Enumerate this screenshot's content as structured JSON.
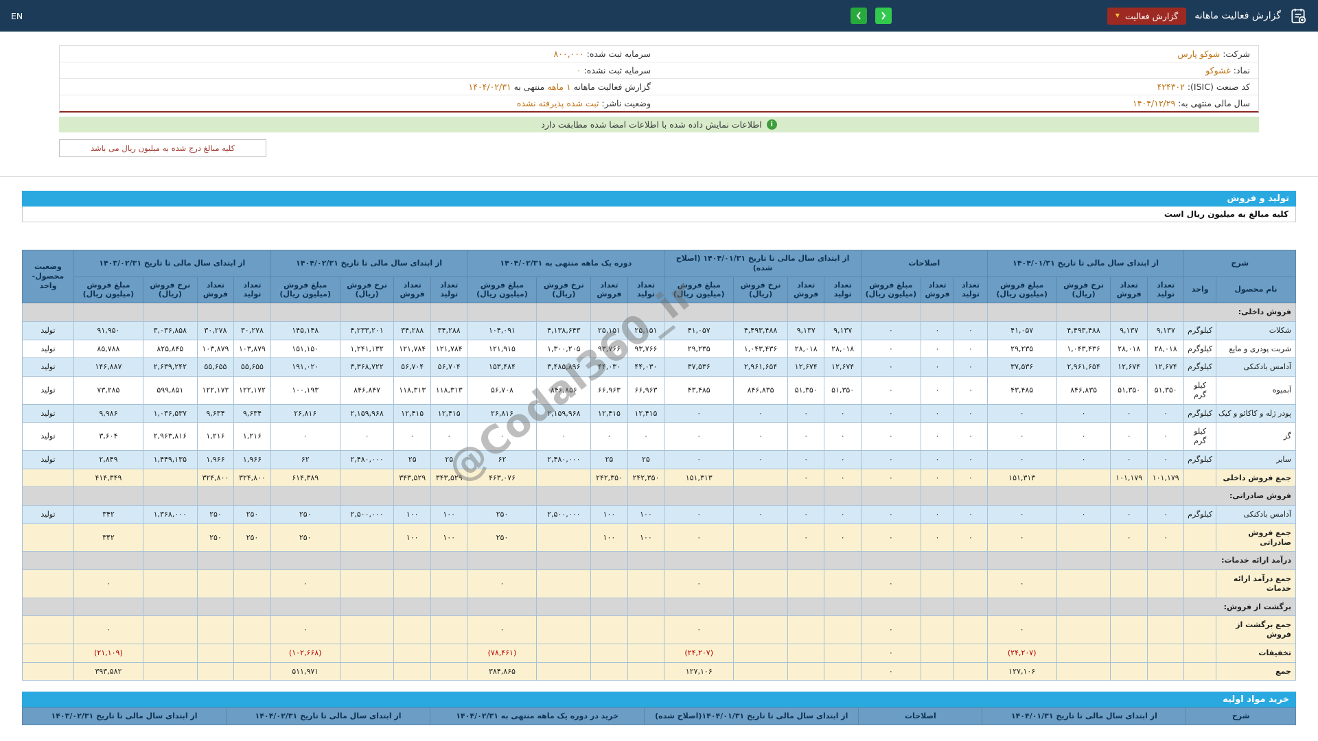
{
  "navbar": {
    "title": "گزارش فعالیت ماهانه",
    "dropdown_label": "گزارش فعالیت",
    "lang": "EN"
  },
  "company_info": {
    "rows": [
      {
        "right": [
          {
            "t": "شرکت: ",
            "c": "lbl"
          },
          {
            "t": "شوکو پارس",
            "c": "val"
          }
        ],
        "left": [
          {
            "t": "سرمایه ثبت شده: ",
            "c": "lbl"
          },
          {
            "t": "۸۰۰,۰۰۰",
            "c": "val"
          }
        ]
      },
      {
        "right": [
          {
            "t": "نماد: ",
            "c": "lbl"
          },
          {
            "t": "غشوکو",
            "c": "val"
          }
        ],
        "left": [
          {
            "t": "سرمایه ثبت نشده: ",
            "c": "lbl"
          },
          {
            "t": "۰",
            "c": "val"
          }
        ]
      },
      {
        "right": [
          {
            "t": "کد صنعت (ISIC): ",
            "c": "lbl"
          },
          {
            "t": "۴۲۴۳۰۲",
            "c": "val"
          }
        ],
        "left": [
          {
            "t": "گزارش فعالیت ماهانه ",
            "c": "lbl"
          },
          {
            "t": "۱ ماهه",
            "c": "val"
          },
          {
            "t": " منتهی به ",
            "c": "lbl"
          },
          {
            "t": "۱۴۰۴/۰۲/۳۱",
            "c": "val"
          }
        ]
      },
      {
        "right": [
          {
            "t": "سال مالی منتهی به: ",
            "c": "lbl"
          },
          {
            "t": "۱۴۰۴/۱۲/۲۹",
            "c": "val"
          }
        ],
        "left": [
          {
            "t": "وضعیت ناشر: ",
            "c": "lbl"
          },
          {
            "t": "ثبت شده پذیرفته نشده",
            "c": "val"
          }
        ]
      }
    ]
  },
  "banner": {
    "text": "اطلاعات نمایش داده شده با اطلاعات امضا شده مطابقت دارد"
  },
  "amounts_note": "کلیه مبالغ درج شده به میلیون ریال می باشد",
  "production": {
    "title": "تولید و فروش",
    "note": "کلیه مبالغ به میلیون ریال است"
  },
  "materials": {
    "title": "خرید مواد اولیه"
  },
  "watermark": "@Codal360_ir",
  "production_table": {
    "header_groups": [
      {
        "title": "شرح",
        "subs": [
          "نام محصول",
          "واحد"
        ]
      },
      {
        "title": "از ابتدای سال مالی تا تاریخ ۱۴۰۴/۰۱/۳۱",
        "subs": [
          "تعداد تولید",
          "تعداد فروش",
          "نرخ فروش (ریال)",
          "مبلغ فروش (میلیون ریال)"
        ]
      },
      {
        "title": "اصلاحات",
        "subs": [
          "تعداد تولید",
          "تعداد فروش",
          "مبلغ فروش (میلیون ریال)"
        ]
      },
      {
        "title": "از ابتدای سال مالی تا تاریخ ۱۴۰۴/۰۱/۳۱ (اصلاح شده)",
        "subs": [
          "تعداد تولید",
          "تعداد فروش",
          "نرخ فروش (ریال)",
          "مبلغ فروش (میلیون ریال)"
        ]
      },
      {
        "title": "دوره یک ماهه منتهی به ۱۴۰۴/۰۲/۳۱",
        "subs": [
          "تعداد تولید",
          "تعداد فروش",
          "نرخ فروش (ریال)",
          "مبلغ فروش (میلیون ریال)"
        ]
      },
      {
        "title": "از ابتدای سال مالی تا تاریخ ۱۴۰۴/۰۲/۳۱",
        "subs": [
          "تعداد تولید",
          "تعداد فروش",
          "نرخ فروش (ریال)",
          "مبلغ فروش (میلیون ریال)"
        ]
      },
      {
        "title": "از ابتدای سال مالی تا تاریخ ۱۴۰۳/۰۲/۳۱",
        "subs": [
          "تعداد تولید",
          "تعداد فروش",
          "نرخ فروش (ریال)",
          "مبلغ فروش (میلیون ریال)"
        ]
      },
      {
        "title": "وضعیت محصول-واحد",
        "subs": []
      }
    ],
    "rows": [
      {
        "type": "section",
        "label": "فروش داخلی:"
      },
      {
        "type": "data",
        "shade": "blue",
        "cells": [
          "شکلات",
          "کیلوگرم",
          "۹,۱۳۷",
          "۹,۱۳۷",
          "۴,۴۹۳,۴۸۸",
          "۴۱,۰۵۷",
          "۰",
          "۰",
          "۰",
          "۹,۱۳۷",
          "۹,۱۳۷",
          "۴,۴۹۳,۴۸۸",
          "۴۱,۰۵۷",
          "۲۵,۱۵۱",
          "۲۵,۱۵۱",
          "۴,۱۳۸,۶۴۳",
          "۱۰۴,۰۹۱",
          "۳۴,۲۸۸",
          "۳۴,۲۸۸",
          "۴,۲۳۳,۲۰۱",
          "۱۴۵,۱۴۸",
          "۳۰,۲۷۸",
          "۳۰,۲۷۸",
          "۳,۰۳۶,۸۵۸",
          "۹۱,۹۵۰",
          "تولید"
        ]
      },
      {
        "type": "data",
        "shade": "white",
        "cells": [
          "شربت پودری و مایع",
          "کیلوگرم",
          "۲۸,۰۱۸",
          "۲۸,۰۱۸",
          "۱,۰۴۳,۴۳۶",
          "۲۹,۲۳۵",
          "۰",
          "۰",
          "۰",
          "۲۸,۰۱۸",
          "۲۸,۰۱۸",
          "۱,۰۴۳,۴۳۶",
          "۲۹,۲۳۵",
          "۹۳,۷۶۶",
          "۹۳,۷۶۶",
          "۱,۳۰۰,۲۰۵",
          "۱۲۱,۹۱۵",
          "۱۲۱,۷۸۴",
          "۱۲۱,۷۸۴",
          "۱,۲۴۱,۱۳۲",
          "۱۵۱,۱۵۰",
          "۱۰۳,۸۷۹",
          "۱۰۳,۸۷۹",
          "۸۲۵,۸۴۵",
          "۸۵,۷۸۸",
          "تولید"
        ]
      },
      {
        "type": "data",
        "shade": "blue",
        "cells": [
          "آدامس بادکنکی",
          "کیلوگرم",
          "۱۲,۶۷۴",
          "۱۲,۶۷۴",
          "۲,۹۶۱,۶۵۴",
          "۳۷,۵۳۶",
          "۰",
          "۰",
          "۰",
          "۱۲,۶۷۴",
          "۱۲,۶۷۴",
          "۲,۹۶۱,۶۵۴",
          "۳۷,۵۳۶",
          "۴۴,۰۳۰",
          "۴۴,۰۳۰",
          "۳,۴۸۵,۸۹۶",
          "۱۵۳,۴۸۴",
          "۵۶,۷۰۴",
          "۵۶,۷۰۴",
          "۳,۳۶۸,۷۲۲",
          "۱۹۱,۰۲۰",
          "۵۵,۶۵۵",
          "۵۵,۶۵۵",
          "۲,۶۳۹,۲۴۲",
          "۱۴۶,۸۸۷",
          "تولید"
        ]
      },
      {
        "type": "data",
        "shade": "white",
        "cells": [
          "آبمیوه",
          "کیلو گرم",
          "۵۱,۳۵۰",
          "۵۱,۳۵۰",
          "۸۴۶,۸۳۵",
          "۴۳,۴۸۵",
          "۰",
          "۰",
          "۰",
          "۵۱,۳۵۰",
          "۵۱,۳۵۰",
          "۸۴۶,۸۳۵",
          "۴۳,۴۸۵",
          "۶۶,۹۶۳",
          "۶۶,۹۶۳",
          "۸۴۶,۸۵۶",
          "۵۶,۷۰۸",
          "۱۱۸,۳۱۳",
          "۱۱۸,۳۱۳",
          "۸۴۶,۸۴۷",
          "۱۰۰,۱۹۳",
          "۱۲۲,۱۷۲",
          "۱۲۲,۱۷۲",
          "۵۹۹,۸۵۱",
          "۷۳,۲۸۵",
          "تولید"
        ]
      },
      {
        "type": "data",
        "shade": "blue",
        "cells": [
          "پودر ژله و کاکائو و کیک",
          "کیلوگرم",
          "۰",
          "۰",
          "۰",
          "۰",
          "۰",
          "۰",
          "۰",
          "۰",
          "۰",
          "۰",
          "۰",
          "۱۲,۴۱۵",
          "۱۲,۴۱۵",
          "۲,۱۵۹,۹۶۸",
          "۲۶,۸۱۶",
          "۱۲,۴۱۵",
          "۱۲,۴۱۵",
          "۲,۱۵۹,۹۶۸",
          "۲۶,۸۱۶",
          "۹,۶۳۴",
          "۹,۶۳۴",
          "۱,۰۳۶,۵۳۷",
          "۹,۹۸۶",
          "تولید"
        ]
      },
      {
        "type": "data",
        "shade": "white",
        "cells": [
          "گز",
          "کیلو گرم",
          "۰",
          "۰",
          "۰",
          "۰",
          "۰",
          "۰",
          "۰",
          "۰",
          "۰",
          "۰",
          "۰",
          "۰",
          "۰",
          "۰",
          "۰",
          "۰",
          "۰",
          "۰",
          "۰",
          "۱,۲۱۶",
          "۱,۲۱۶",
          "۲,۹۶۳,۸۱۶",
          "۳,۶۰۴",
          "تولید"
        ]
      },
      {
        "type": "data",
        "shade": "blue",
        "cells": [
          "سایر",
          "کیلوگرم",
          "۰",
          "۰",
          "۰",
          "۰",
          "۰",
          "۰",
          "۰",
          "۰",
          "۰",
          "۰",
          "۰",
          "۲۵",
          "۲۵",
          "۲,۴۸۰,۰۰۰",
          "۶۲",
          "۲۵",
          "۲۵",
          "۲,۴۸۰,۰۰۰",
          "۶۲",
          "۱,۹۶۶",
          "۱,۹۶۶",
          "۱,۴۴۹,۱۳۵",
          "۲,۸۴۹",
          "تولید"
        ]
      },
      {
        "type": "total",
        "cells": [
          "جمع فروش داخلی",
          "",
          "۱۰۱,۱۷۹",
          "۱۰۱,۱۷۹",
          "",
          "۱۵۱,۳۱۳",
          "۰",
          "۰",
          "۰",
          "۰",
          "۰",
          "",
          "۱۵۱,۳۱۳",
          "۲۴۲,۳۵۰",
          "۲۴۲,۳۵۰",
          "",
          "۴۶۳,۰۷۶",
          "۳۴۳,۵۲۹",
          "۳۴۳,۵۲۹",
          "",
          "۶۱۴,۳۸۹",
          "۳۲۴,۸۰۰",
          "۳۲۴,۸۰۰",
          "",
          "۴۱۴,۳۴۹",
          ""
        ]
      },
      {
        "type": "section",
        "label": "فروش صادراتی:"
      },
      {
        "type": "data",
        "shade": "blue",
        "cells": [
          "آدامس بادکنکی",
          "کیلوگرم",
          "۰",
          "۰",
          "۰",
          "۰",
          "۰",
          "۰",
          "۰",
          "۰",
          "۰",
          "۰",
          "۰",
          "۱۰۰",
          "۱۰۰",
          "۲,۵۰۰,۰۰۰",
          "۲۵۰",
          "۱۰۰",
          "۱۰۰",
          "۲,۵۰۰,۰۰۰",
          "۲۵۰",
          "۲۵۰",
          "۲۵۰",
          "۱,۳۶۸,۰۰۰",
          "۳۴۲",
          "تولید"
        ]
      },
      {
        "type": "total",
        "cells": [
          "جمع فروش صادراتی",
          "",
          "۰",
          "۰",
          "",
          "۰",
          "۰",
          "۰",
          "۰",
          "۰",
          "۰",
          "",
          "۰",
          "۱۰۰",
          "۱۰۰",
          "",
          "۲۵۰",
          "۱۰۰",
          "۱۰۰",
          "",
          "۲۵۰",
          "۲۵۰",
          "۲۵۰",
          "",
          "۳۴۲",
          ""
        ]
      },
      {
        "type": "section",
        "label": "درآمد ارائه خدمات:"
      },
      {
        "type": "total",
        "cells": [
          "جمع درآمد ارائه خدمات",
          "",
          "",
          "",
          "",
          "۰",
          "",
          "",
          "۰",
          "",
          "",
          "",
          "۰",
          "",
          "",
          "",
          "۰",
          "",
          "",
          "",
          "۰",
          "",
          "",
          "",
          "۰",
          ""
        ]
      },
      {
        "type": "section",
        "label": "برگشت از فروش:"
      },
      {
        "type": "total",
        "cells": [
          "جمع برگشت از فروش",
          "",
          "",
          "",
          "",
          "۰",
          "",
          "",
          "۰",
          "",
          "",
          "",
          "۰",
          "",
          "",
          "",
          "۰",
          "",
          "",
          "",
          "۰",
          "",
          "",
          "",
          "۰",
          ""
        ]
      },
      {
        "type": "total",
        "cells": [
          "تخفیفات",
          "",
          "",
          "",
          "",
          "(۲۴,۲۰۷)",
          "",
          "",
          "۰",
          "",
          "",
          "",
          "(۲۴,۲۰۷)",
          "",
          "",
          "",
          "(۷۸,۴۶۱)",
          "",
          "",
          "",
          "(۱۰۲,۶۶۸)",
          "",
          "",
          "",
          "(۲۱,۱۰۹)",
          ""
        ]
      },
      {
        "type": "total",
        "cells": [
          "جمع",
          "",
          "",
          "",
          "",
          "۱۲۷,۱۰۶",
          "",
          "",
          "۰",
          "",
          "",
          "",
          "۱۲۷,۱۰۶",
          "",
          "",
          "",
          "۳۸۴,۸۶۵",
          "",
          "",
          "",
          "۵۱۱,۹۷۱",
          "",
          "",
          "",
          "۳۹۳,۵۸۲",
          ""
        ]
      }
    ]
  },
  "materials_table": {
    "header_groups": [
      "شرح",
      "از ابتدای سال مالی تا تاریخ ۱۴۰۴/۰۱/۳۱",
      "اصلاحات",
      "از ابتدای سال مالی تا تاریخ ۱۴۰۴/۰۱/۳۱(اصلاح شده)",
      "خرید در دوره یک ماهه منتهی به ۱۴۰۴/۰۲/۳۱",
      "از ابتدای سال مالی تا تاریخ ۱۴۰۴/۰۲/۳۱",
      "از ابتدای سال مالی تا تاریخ ۱۴۰۳/۰۲/۳۱"
    ]
  }
}
